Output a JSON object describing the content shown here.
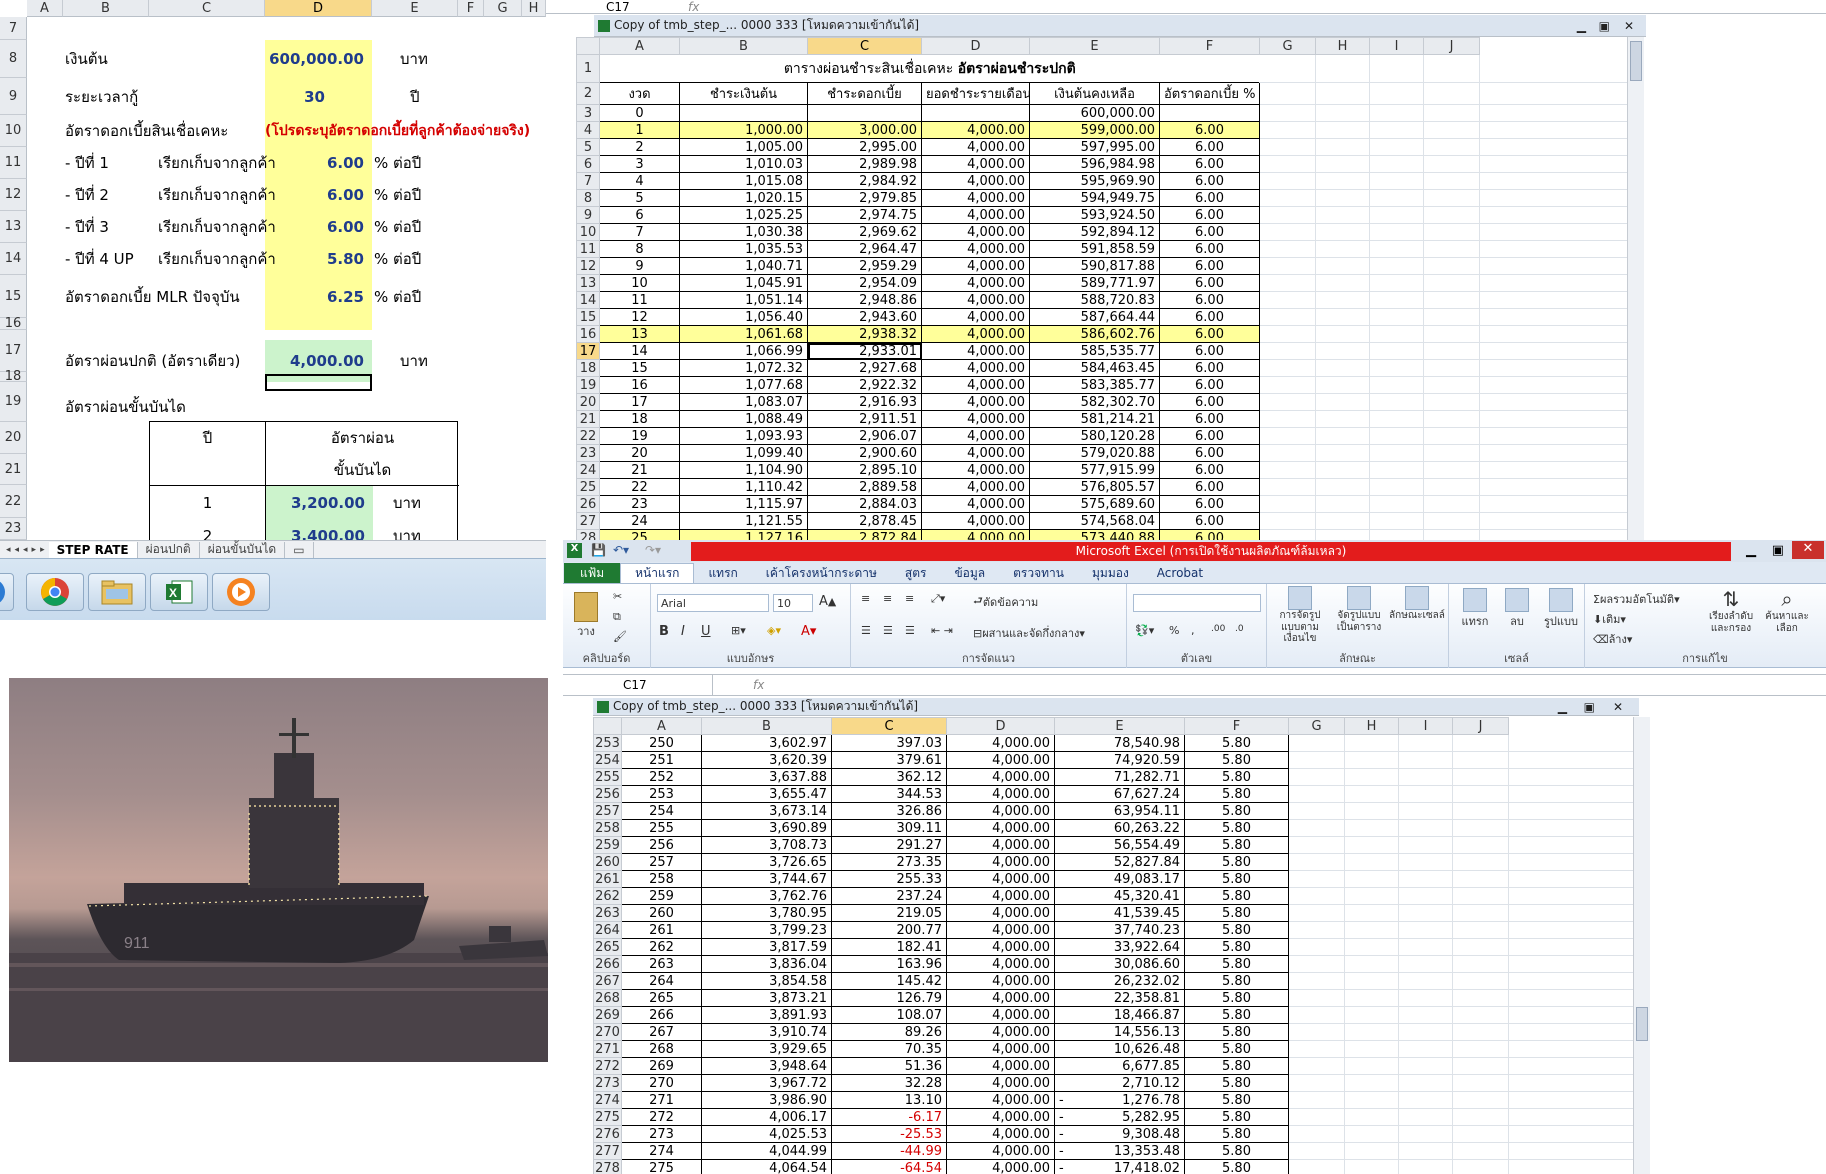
{
  "left_sheet": {
    "col_headers": [
      "A",
      "B",
      "C",
      "D",
      "E",
      "F",
      "G",
      "H"
    ],
    "row_nums": [
      "7",
      "8",
      "9",
      "10",
      "11",
      "12",
      "13",
      "14",
      "15",
      "16",
      "17",
      "18",
      "19",
      "20",
      "21",
      "22",
      "23"
    ],
    "principal_label": "เงินต้น",
    "principal_value": "600,000.00",
    "principal_unit": "บาท",
    "term_label": "ระยะเวลากู้",
    "term_value": "30",
    "term_unit": "ปี",
    "rate_label": "อัตราดอกเบี้ยสินเชื่อเคหะ",
    "rate_note": "(โปรดระบุอัตราดอกเบี้ยที่ลูกค้าต้องจ่ายจริง)",
    "rate_rows": [
      {
        "year": "- ปีที่ 1",
        "desc": "เรียกเก็บจากลูกค้า",
        "value": "6.00",
        "unit": "% ต่อปี"
      },
      {
        "year": "- ปีที่ 2",
        "desc": "เรียกเก็บจากลูกค้า",
        "value": "6.00",
        "unit": "% ต่อปี"
      },
      {
        "year": "- ปีที่ 3",
        "desc": "เรียกเก็บจากลูกค้า",
        "value": "6.00",
        "unit": "% ต่อปี"
      },
      {
        "year": "- ปีที่ 4 UP",
        "desc": "เรียกเก็บจากลูกค้า",
        "value": "5.80",
        "unit": "% ต่อปี"
      }
    ],
    "mlr_label": "อัตราดอกเบี้ย MLR ปัจจุบัน",
    "mlr_value": "6.25",
    "mlr_unit": "% ต่อปี",
    "normal_label": "อัตราผ่อนปกติ (อัตราเดียว)",
    "normal_value": "4,000.00",
    "normal_unit": "บาท",
    "step_label": "อัตราผ่อนขั้นบันได",
    "step_head_year": "ปี",
    "step_head_rate1": "อัตราผ่อน",
    "step_head_rate2": "ขั้นบันได",
    "step_rows": [
      {
        "year": "1",
        "value": "3,200.00",
        "unit": "บาท"
      },
      {
        "year": "2",
        "value": "3,400.00",
        "unit": "บาท"
      }
    ],
    "tabs": [
      "STEP RATE",
      "ผ่อนปกติ",
      "ผ่อนขั้นบันได"
    ]
  },
  "top_window": {
    "namebox": "C17",
    "fx": "fx",
    "title": "Copy of tmb_step_... 0000 333  [โหมดความเข้ากันได้]",
    "col_headers": [
      "A",
      "B",
      "C",
      "D",
      "E",
      "F",
      "G",
      "H",
      "I",
      "J"
    ],
    "table_title_a": "ตารางผ่อนชำระสินเชื่อเคหะ",
    "table_title_b": "อัตราผ่อนชำระปกติ",
    "headers": [
      "งวด",
      "ชำระเงินต้น",
      "ชำระดอกเบี้ย",
      "ยอดชำระรายเดือน",
      "เงินต้นคงเหลือ",
      "อัตราดอกเบี้ย %"
    ],
    "row3": {
      "rn": "3",
      "n": "0",
      "bal": "600,000.00"
    },
    "rows": [
      {
        "rn": "4",
        "n": "1",
        "p": "1,000.00",
        "i": "3,000.00",
        "m": "4,000.00",
        "b": "599,000.00",
        "r": "6.00",
        "hl": true
      },
      {
        "rn": "5",
        "n": "2",
        "p": "1,005.00",
        "i": "2,995.00",
        "m": "4,000.00",
        "b": "597,995.00",
        "r": "6.00"
      },
      {
        "rn": "6",
        "n": "3",
        "p": "1,010.03",
        "i": "2,989.98",
        "m": "4,000.00",
        "b": "596,984.98",
        "r": "6.00"
      },
      {
        "rn": "7",
        "n": "4",
        "p": "1,015.08",
        "i": "2,984.92",
        "m": "4,000.00",
        "b": "595,969.90",
        "r": "6.00"
      },
      {
        "rn": "8",
        "n": "5",
        "p": "1,020.15",
        "i": "2,979.85",
        "m": "4,000.00",
        "b": "594,949.75",
        "r": "6.00"
      },
      {
        "rn": "9",
        "n": "6",
        "p": "1,025.25",
        "i": "2,974.75",
        "m": "4,000.00",
        "b": "593,924.50",
        "r": "6.00"
      },
      {
        "rn": "10",
        "n": "7",
        "p": "1,030.38",
        "i": "2,969.62",
        "m": "4,000.00",
        "b": "592,894.12",
        "r": "6.00"
      },
      {
        "rn": "11",
        "n": "8",
        "p": "1,035.53",
        "i": "2,964.47",
        "m": "4,000.00",
        "b": "591,858.59",
        "r": "6.00"
      },
      {
        "rn": "12",
        "n": "9",
        "p": "1,040.71",
        "i": "2,959.29",
        "m": "4,000.00",
        "b": "590,817.88",
        "r": "6.00"
      },
      {
        "rn": "13",
        "n": "10",
        "p": "1,045.91",
        "i": "2,954.09",
        "m": "4,000.00",
        "b": "589,771.97",
        "r": "6.00"
      },
      {
        "rn": "14",
        "n": "11",
        "p": "1,051.14",
        "i": "2,948.86",
        "m": "4,000.00",
        "b": "588,720.83",
        "r": "6.00"
      },
      {
        "rn": "15",
        "n": "12",
        "p": "1,056.40",
        "i": "2,943.60",
        "m": "4,000.00",
        "b": "587,664.44",
        "r": "6.00"
      },
      {
        "rn": "16",
        "n": "13",
        "p": "1,061.68",
        "i": "2,938.32",
        "m": "4,000.00",
        "b": "586,602.76",
        "r": "6.00",
        "hl": true
      },
      {
        "rn": "17",
        "n": "14",
        "p": "1,066.99",
        "i": "2,933.01",
        "m": "4,000.00",
        "b": "585,535.77",
        "r": "6.00"
      },
      {
        "rn": "18",
        "n": "15",
        "p": "1,072.32",
        "i": "2,927.68",
        "m": "4,000.00",
        "b": "584,463.45",
        "r": "6.00"
      },
      {
        "rn": "19",
        "n": "16",
        "p": "1,077.68",
        "i": "2,922.32",
        "m": "4,000.00",
        "b": "583,385.77",
        "r": "6.00"
      },
      {
        "rn": "20",
        "n": "17",
        "p": "1,083.07",
        "i": "2,916.93",
        "m": "4,000.00",
        "b": "582,302.70",
        "r": "6.00"
      },
      {
        "rn": "21",
        "n": "18",
        "p": "1,088.49",
        "i": "2,911.51",
        "m": "4,000.00",
        "b": "581,214.21",
        "r": "6.00"
      },
      {
        "rn": "22",
        "n": "19",
        "p": "1,093.93",
        "i": "2,906.07",
        "m": "4,000.00",
        "b": "580,120.28",
        "r": "6.00"
      },
      {
        "rn": "23",
        "n": "20",
        "p": "1,099.40",
        "i": "2,900.60",
        "m": "4,000.00",
        "b": "579,020.88",
        "r": "6.00"
      },
      {
        "rn": "24",
        "n": "21",
        "p": "1,104.90",
        "i": "2,895.10",
        "m": "4,000.00",
        "b": "577,915.99",
        "r": "6.00"
      },
      {
        "rn": "25",
        "n": "22",
        "p": "1,110.42",
        "i": "2,889.58",
        "m": "4,000.00",
        "b": "576,805.57",
        "r": "6.00"
      },
      {
        "rn": "26",
        "n": "23",
        "p": "1,115.97",
        "i": "2,884.03",
        "m": "4,000.00",
        "b": "575,689.60",
        "r": "6.00"
      },
      {
        "rn": "27",
        "n": "24",
        "p": "1,121.55",
        "i": "2,878.45",
        "m": "4,000.00",
        "b": "574,568.04",
        "r": "6.00"
      },
      {
        "rn": "28",
        "n": "25",
        "p": "1,127.16",
        "i": "2,872.84",
        "m": "4,000.00",
        "b": "573,440.88",
        "r": "6.00",
        "hl": true
      }
    ]
  },
  "excel": {
    "app_title": "Microsoft Excel (การเปิดใช้งานผลิตภัณฑ์ล้มเหลว)",
    "tabs": [
      "แฟ้ม",
      "หน้าแรก",
      "แทรก",
      "เค้าโครงหน้ากระดาษ",
      "สูตร",
      "ข้อมูล",
      "ตรวจทาน",
      "มุมมอง",
      "Acrobat"
    ],
    "font_name": "Arial",
    "font_size": "10",
    "groups": [
      "คลิปบอร์ด",
      "แบบอักษร",
      "การจัดแนว",
      "ตัวเลข",
      "ลักษณะ",
      "เซลล์",
      "การแก้ไข"
    ],
    "paste": "วาง",
    "wrap_text": "ตัดข้อความ",
    "merge_center": "ผสานและจัดกึ่งกลาง",
    "cond_format": "การจัดรูปแบบตามเงื่อนไข",
    "format_table": "จัดรูปแบบเป็นตาราง",
    "cell_styles": "ลักษณะเซลล์",
    "insert": "แทรก",
    "delete": "ลบ",
    "format": "รูปแบบ",
    "autosum": "ผลรวมอัตโนมัติ",
    "fill": "เติม",
    "clear": "ล้าง",
    "sort_filter": "เรียงลำดับและกรอง",
    "find_select": "ค้นหาและเลือก",
    "namebox": "C17",
    "fx": "fx",
    "title": "Copy of tmb_step_... 0000 333  [โหมดความเข้ากันได้]",
    "col_headers": [
      "A",
      "B",
      "C",
      "D",
      "E",
      "F",
      "G",
      "H",
      "I",
      "J"
    ],
    "rows": [
      {
        "rn": "253",
        "n": "250",
        "p": "3,602.97",
        "i": "397.03",
        "m": "4,000.00",
        "b": "78,540.98",
        "r": "5.80"
      },
      {
        "rn": "254",
        "n": "251",
        "p": "3,620.39",
        "i": "379.61",
        "m": "4,000.00",
        "b": "74,920.59",
        "r": "5.80"
      },
      {
        "rn": "255",
        "n": "252",
        "p": "3,637.88",
        "i": "362.12",
        "m": "4,000.00",
        "b": "71,282.71",
        "r": "5.80"
      },
      {
        "rn": "256",
        "n": "253",
        "p": "3,655.47",
        "i": "344.53",
        "m": "4,000.00",
        "b": "67,627.24",
        "r": "5.80"
      },
      {
        "rn": "257",
        "n": "254",
        "p": "3,673.14",
        "i": "326.86",
        "m": "4,000.00",
        "b": "63,954.11",
        "r": "5.80"
      },
      {
        "rn": "258",
        "n": "255",
        "p": "3,690.89",
        "i": "309.11",
        "m": "4,000.00",
        "b": "60,263.22",
        "r": "5.80"
      },
      {
        "rn": "259",
        "n": "256",
        "p": "3,708.73",
        "i": "291.27",
        "m": "4,000.00",
        "b": "56,554.49",
        "r": "5.80"
      },
      {
        "rn": "260",
        "n": "257",
        "p": "3,726.65",
        "i": "273.35",
        "m": "4,000.00",
        "b": "52,827.84",
        "r": "5.80"
      },
      {
        "rn": "261",
        "n": "258",
        "p": "3,744.67",
        "i": "255.33",
        "m": "4,000.00",
        "b": "49,083.17",
        "r": "5.80"
      },
      {
        "rn": "262",
        "n": "259",
        "p": "3,762.76",
        "i": "237.24",
        "m": "4,000.00",
        "b": "45,320.41",
        "r": "5.80"
      },
      {
        "rn": "263",
        "n": "260",
        "p": "3,780.95",
        "i": "219.05",
        "m": "4,000.00",
        "b": "41,539.45",
        "r": "5.80"
      },
      {
        "rn": "264",
        "n": "261",
        "p": "3,799.23",
        "i": "200.77",
        "m": "4,000.00",
        "b": "37,740.23",
        "r": "5.80"
      },
      {
        "rn": "265",
        "n": "262",
        "p": "3,817.59",
        "i": "182.41",
        "m": "4,000.00",
        "b": "33,922.64",
        "r": "5.80"
      },
      {
        "rn": "266",
        "n": "263",
        "p": "3,836.04",
        "i": "163.96",
        "m": "4,000.00",
        "b": "30,086.60",
        "r": "5.80"
      },
      {
        "rn": "267",
        "n": "264",
        "p": "3,854.58",
        "i": "145.42",
        "m": "4,000.00",
        "b": "26,232.02",
        "r": "5.80"
      },
      {
        "rn": "268",
        "n": "265",
        "p": "3,873.21",
        "i": "126.79",
        "m": "4,000.00",
        "b": "22,358.81",
        "r": "5.80"
      },
      {
        "rn": "269",
        "n": "266",
        "p": "3,891.93",
        "i": "108.07",
        "m": "4,000.00",
        "b": "18,466.87",
        "r": "5.80"
      },
      {
        "rn": "270",
        "n": "267",
        "p": "3,910.74",
        "i": "89.26",
        "m": "4,000.00",
        "b": "14,556.13",
        "r": "5.80"
      },
      {
        "rn": "271",
        "n": "268",
        "p": "3,929.65",
        "i": "70.35",
        "m": "4,000.00",
        "b": "10,626.48",
        "r": "5.80"
      },
      {
        "rn": "272",
        "n": "269",
        "p": "3,948.64",
        "i": "51.36",
        "m": "4,000.00",
        "b": "6,677.85",
        "r": "5.80"
      },
      {
        "rn": "273",
        "n": "270",
        "p": "3,967.72",
        "i": "32.28",
        "m": "4,000.00",
        "b": "2,710.12",
        "r": "5.80"
      },
      {
        "rn": "274",
        "n": "271",
        "p": "3,986.90",
        "i": "13.10",
        "m": "4,000.00",
        "b": "1,276.78",
        "r": "5.80",
        "dash": "-"
      },
      {
        "rn": "275",
        "n": "272",
        "p": "4,006.17",
        "i": "-6.17",
        "m": "4,000.00",
        "b": "5,282.95",
        "r": "5.80",
        "dash": "-",
        "neg": true
      },
      {
        "rn": "276",
        "n": "273",
        "p": "4,025.53",
        "i": "-25.53",
        "m": "4,000.00",
        "b": "9,308.48",
        "r": "5.80",
        "dash": "-",
        "neg": true
      },
      {
        "rn": "277",
        "n": "274",
        "p": "4,044.99",
        "i": "-44.99",
        "m": "4,000.00",
        "b": "13,353.48",
        "r": "5.80",
        "dash": "-",
        "neg": true
      },
      {
        "rn": "278",
        "n": "275",
        "p": "4,064.54",
        "i": "-64.54",
        "m": "4,000.00",
        "b": "17,418.02",
        "r": "5.80",
        "dash": "-",
        "neg": true
      }
    ]
  },
  "taskbar": {
    "icons": [
      "chrome-icon",
      "explorer-icon",
      "excel-icon",
      "media-player-icon"
    ]
  },
  "colors": {
    "yellow": "#ffff9a",
    "green": "#ccf3cc",
    "red_title": "#e31c1c",
    "negative": "#d40000"
  }
}
